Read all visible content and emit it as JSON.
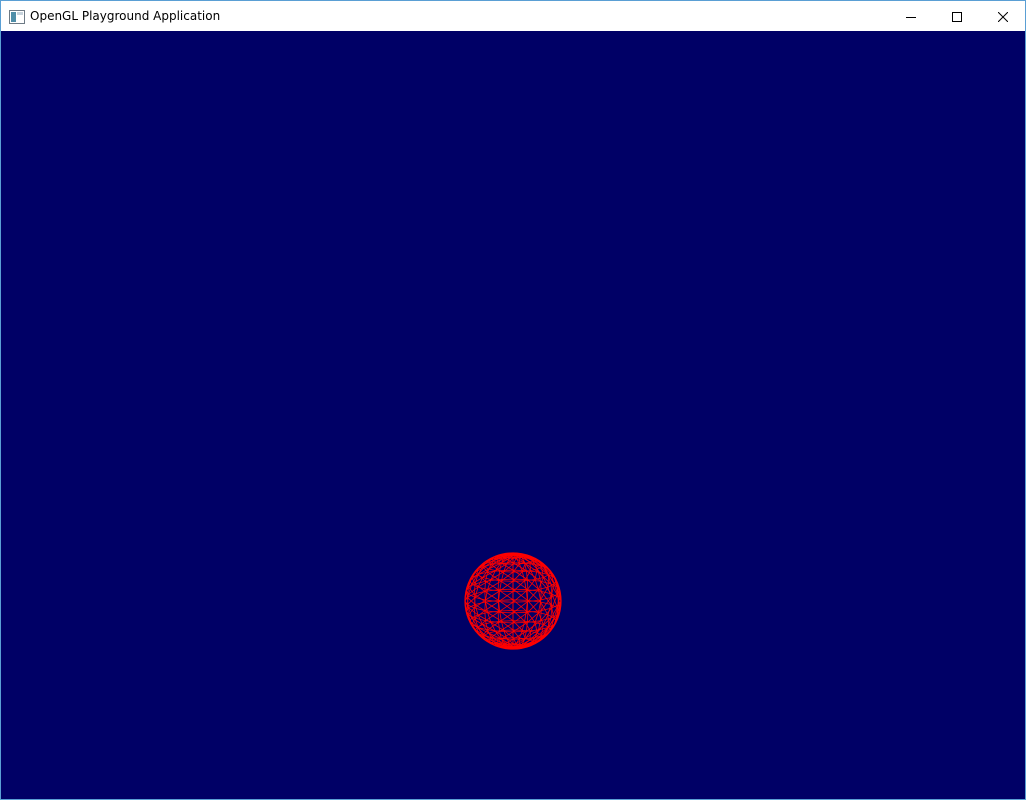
{
  "window": {
    "title": "OpenGL Playground Application",
    "icon": "application-window-icon",
    "controls": {
      "minimize_icon": "minimize-icon",
      "maximize_icon": "maximize-icon",
      "close_icon": "close-icon"
    }
  },
  "scene": {
    "background_color": "#000066",
    "object": {
      "type": "wireframe-sphere",
      "color": "#ff0000"
    }
  }
}
